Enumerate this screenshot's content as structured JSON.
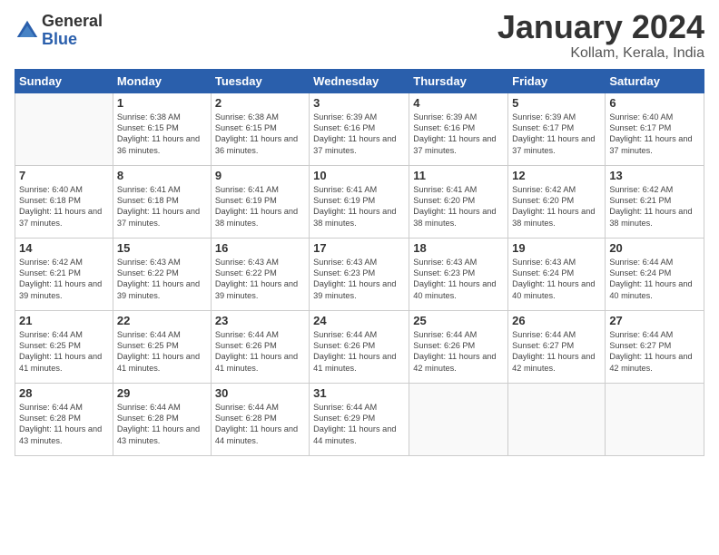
{
  "logo": {
    "general": "General",
    "blue": "Blue"
  },
  "title": "January 2024",
  "subtitle": "Kollam, Kerala, India",
  "headers": [
    "Sunday",
    "Monday",
    "Tuesday",
    "Wednesday",
    "Thursday",
    "Friday",
    "Saturday"
  ],
  "weeks": [
    [
      {
        "day": "",
        "info": ""
      },
      {
        "day": "1",
        "info": "Sunrise: 6:38 AM\nSunset: 6:15 PM\nDaylight: 11 hours\nand 36 minutes."
      },
      {
        "day": "2",
        "info": "Sunrise: 6:38 AM\nSunset: 6:15 PM\nDaylight: 11 hours\nand 36 minutes."
      },
      {
        "day": "3",
        "info": "Sunrise: 6:39 AM\nSunset: 6:16 PM\nDaylight: 11 hours\nand 37 minutes."
      },
      {
        "day": "4",
        "info": "Sunrise: 6:39 AM\nSunset: 6:16 PM\nDaylight: 11 hours\nand 37 minutes."
      },
      {
        "day": "5",
        "info": "Sunrise: 6:39 AM\nSunset: 6:17 PM\nDaylight: 11 hours\nand 37 minutes."
      },
      {
        "day": "6",
        "info": "Sunrise: 6:40 AM\nSunset: 6:17 PM\nDaylight: 11 hours\nand 37 minutes."
      }
    ],
    [
      {
        "day": "7",
        "info": "Sunrise: 6:40 AM\nSunset: 6:18 PM\nDaylight: 11 hours\nand 37 minutes."
      },
      {
        "day": "8",
        "info": "Sunrise: 6:41 AM\nSunset: 6:18 PM\nDaylight: 11 hours\nand 37 minutes."
      },
      {
        "day": "9",
        "info": "Sunrise: 6:41 AM\nSunset: 6:19 PM\nDaylight: 11 hours\nand 38 minutes."
      },
      {
        "day": "10",
        "info": "Sunrise: 6:41 AM\nSunset: 6:19 PM\nDaylight: 11 hours\nand 38 minutes."
      },
      {
        "day": "11",
        "info": "Sunrise: 6:41 AM\nSunset: 6:20 PM\nDaylight: 11 hours\nand 38 minutes."
      },
      {
        "day": "12",
        "info": "Sunrise: 6:42 AM\nSunset: 6:20 PM\nDaylight: 11 hours\nand 38 minutes."
      },
      {
        "day": "13",
        "info": "Sunrise: 6:42 AM\nSunset: 6:21 PM\nDaylight: 11 hours\nand 38 minutes."
      }
    ],
    [
      {
        "day": "14",
        "info": "Sunrise: 6:42 AM\nSunset: 6:21 PM\nDaylight: 11 hours\nand 39 minutes."
      },
      {
        "day": "15",
        "info": "Sunrise: 6:43 AM\nSunset: 6:22 PM\nDaylight: 11 hours\nand 39 minutes."
      },
      {
        "day": "16",
        "info": "Sunrise: 6:43 AM\nSunset: 6:22 PM\nDaylight: 11 hours\nand 39 minutes."
      },
      {
        "day": "17",
        "info": "Sunrise: 6:43 AM\nSunset: 6:23 PM\nDaylight: 11 hours\nand 39 minutes."
      },
      {
        "day": "18",
        "info": "Sunrise: 6:43 AM\nSunset: 6:23 PM\nDaylight: 11 hours\nand 40 minutes."
      },
      {
        "day": "19",
        "info": "Sunrise: 6:43 AM\nSunset: 6:24 PM\nDaylight: 11 hours\nand 40 minutes."
      },
      {
        "day": "20",
        "info": "Sunrise: 6:44 AM\nSunset: 6:24 PM\nDaylight: 11 hours\nand 40 minutes."
      }
    ],
    [
      {
        "day": "21",
        "info": "Sunrise: 6:44 AM\nSunset: 6:25 PM\nDaylight: 11 hours\nand 41 minutes."
      },
      {
        "day": "22",
        "info": "Sunrise: 6:44 AM\nSunset: 6:25 PM\nDaylight: 11 hours\nand 41 minutes."
      },
      {
        "day": "23",
        "info": "Sunrise: 6:44 AM\nSunset: 6:26 PM\nDaylight: 11 hours\nand 41 minutes."
      },
      {
        "day": "24",
        "info": "Sunrise: 6:44 AM\nSunset: 6:26 PM\nDaylight: 11 hours\nand 41 minutes."
      },
      {
        "day": "25",
        "info": "Sunrise: 6:44 AM\nSunset: 6:26 PM\nDaylight: 11 hours\nand 42 minutes."
      },
      {
        "day": "26",
        "info": "Sunrise: 6:44 AM\nSunset: 6:27 PM\nDaylight: 11 hours\nand 42 minutes."
      },
      {
        "day": "27",
        "info": "Sunrise: 6:44 AM\nSunset: 6:27 PM\nDaylight: 11 hours\nand 42 minutes."
      }
    ],
    [
      {
        "day": "28",
        "info": "Sunrise: 6:44 AM\nSunset: 6:28 PM\nDaylight: 11 hours\nand 43 minutes."
      },
      {
        "day": "29",
        "info": "Sunrise: 6:44 AM\nSunset: 6:28 PM\nDaylight: 11 hours\nand 43 minutes."
      },
      {
        "day": "30",
        "info": "Sunrise: 6:44 AM\nSunset: 6:28 PM\nDaylight: 11 hours\nand 44 minutes."
      },
      {
        "day": "31",
        "info": "Sunrise: 6:44 AM\nSunset: 6:29 PM\nDaylight: 11 hours\nand 44 minutes."
      },
      {
        "day": "",
        "info": ""
      },
      {
        "day": "",
        "info": ""
      },
      {
        "day": "",
        "info": ""
      }
    ]
  ]
}
